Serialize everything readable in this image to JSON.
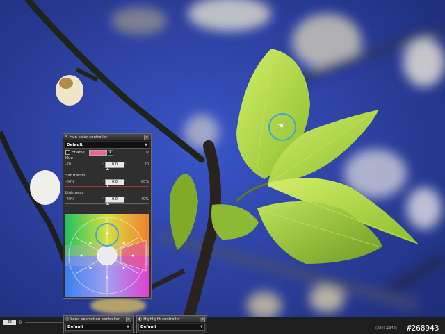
{
  "colors": {
    "accent_ring": "#3aa6e0",
    "hue_swatch": "#f0629a",
    "panel_bg": "#2f2f2f"
  },
  "hue_panel": {
    "title": "Hue color controller",
    "preset": "Default",
    "enable_label": "Enable",
    "hue": {
      "label": "Hue",
      "min": "-20",
      "max": "20",
      "value": "0.0"
    },
    "saturation": {
      "label": "Saturation",
      "min": "-60%",
      "max": "60%",
      "value": "0.0"
    },
    "lightness": {
      "label": "Lightness",
      "min": "-40%",
      "max": "40%",
      "value": "0.0"
    }
  },
  "lens_panel": {
    "title": "Lens aberration controller",
    "preset": "Default"
  },
  "highlight_panel": {
    "title": "Highlight controller",
    "preset": "Default"
  },
  "statusbar": {
    "zoom": "36",
    "coords": "(2803,1342)",
    "image_id": "#268943"
  }
}
